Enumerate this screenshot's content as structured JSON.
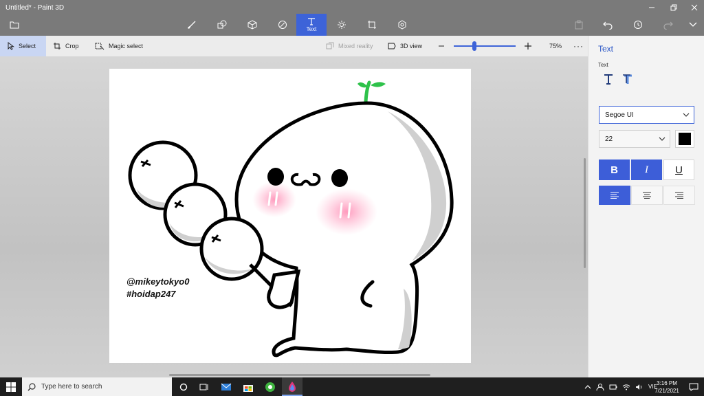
{
  "window": {
    "title": "Untitled* - Paint 3D"
  },
  "toolbar": {
    "tools": [
      {
        "icon": "brushes-icon",
        "label": ""
      },
      {
        "icon": "2d-shapes-icon",
        "label": ""
      },
      {
        "icon": "3d-shapes-icon",
        "label": ""
      },
      {
        "icon": "stickers-icon",
        "label": ""
      },
      {
        "icon": "text-icon",
        "label": "Text",
        "active": true
      },
      {
        "icon": "effects-icon",
        "label": ""
      },
      {
        "icon": "canvas-icon",
        "label": ""
      },
      {
        "icon": "3d-library-icon",
        "label": ""
      }
    ],
    "accent_color": "#3d63d8"
  },
  "subbar": {
    "select_label": "Select",
    "crop_label": "Crop",
    "magic_select_label": "Magic select",
    "mixed_reality_label": "Mixed reality",
    "view3d_label": "3D view",
    "zoom_value": "75%",
    "zoom_level": 0.33
  },
  "canvas": {
    "watermark_line1": "@mikeytokyo0",
    "watermark_line2": "#hoidap247"
  },
  "panel": {
    "title": "Text",
    "subtitle": "Text",
    "font_family": "Segoe UI",
    "font_size": "22",
    "text_color": "#000000",
    "bold": true,
    "italic": true,
    "underline": false,
    "alignment": "left"
  },
  "taskbar": {
    "search_placeholder": "Type here to search",
    "language": "VIE",
    "time": "3:16 PM",
    "date": "7/21/2021"
  }
}
